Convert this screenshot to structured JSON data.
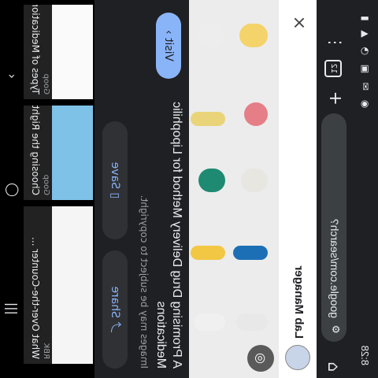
{
  "status": {
    "time": "8:28",
    "icons": "◉ ✉ ▣ ◔ ▲ ▮"
  },
  "browser": {
    "url": "google.com/search?",
    "tab_count": "12",
    "home_icon": "home-icon",
    "menu_icon": "more-vert-icon"
  },
  "site": {
    "name": "Lab Manager",
    "close": "×"
  },
  "result": {
    "title": "A Promising Drug Delivery Method for Lipophilic Medications",
    "subtitle": "Images may be subject to copyright.",
    "visit_label": "Visit",
    "share_label": "Share",
    "save_label": "Save"
  },
  "related": [
    {
      "source": "RBK",
      "title": "What Over-the-Counter ..."
    },
    {
      "source": "Goop",
      "title": "Choosing the Right Type of ..."
    },
    {
      "source": "Goop",
      "title": "Types of Medications & ..."
    }
  ],
  "colors": {
    "accent": "#8ab4f8",
    "bg": "#1f2023"
  }
}
